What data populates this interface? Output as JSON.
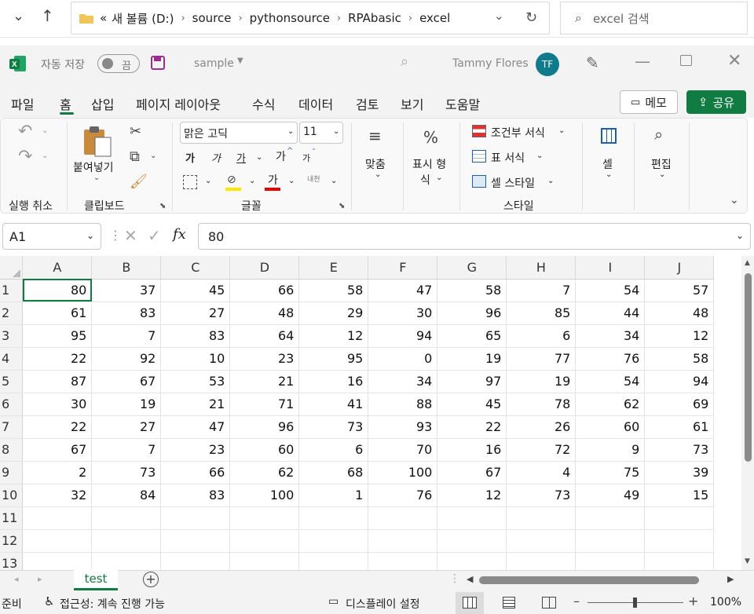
{
  "explorer": {
    "path": [
      "새 볼륨 (D:)",
      "source",
      "pythonsource",
      "RPAbasic",
      "excel"
    ],
    "path_prefix": "«",
    "search_placeholder": "excel 검색"
  },
  "titlebar": {
    "autosave_label": "자동 저장",
    "autosave_state": "끔",
    "file_name": "sample",
    "user_name": "Tammy Flores",
    "user_initials": "TF"
  },
  "menu": {
    "tabs": [
      "파일",
      "홈",
      "삽입",
      "페이지 레이아웃",
      "수식",
      "데이터",
      "검토",
      "보기",
      "도움말"
    ],
    "active_tab": "홈",
    "memo_label": "메모",
    "share_label": "공유"
  },
  "ribbon": {
    "undo_group": "실행 취소",
    "clipboard_group": "클립보드",
    "paste_label": "붙여넣기",
    "font_group": "글꼴",
    "font_name": "맑은 고딕",
    "font_size": "11",
    "bold": "가",
    "italic": "가",
    "underline": "가",
    "grow": "가",
    "shrink": "가",
    "font_color_glyph": "가",
    "phonetic": "내천",
    "align_label": "맞춤",
    "number_label_1": "표시 형",
    "number_label_2": "식",
    "styles_group": "스타일",
    "cond_format": "조건부 서식",
    "table_format": "표 서식",
    "cell_style": "셀 스타일",
    "cells_label": "셀",
    "edit_label": "편집"
  },
  "formula_bar": {
    "name_box": "A1",
    "fx": "fx",
    "value": "80"
  },
  "grid": {
    "columns": [
      "A",
      "B",
      "C",
      "D",
      "E",
      "F",
      "G",
      "H",
      "I",
      "J"
    ],
    "rows": [
      {
        "num": "1",
        "cells": [
          "80",
          "37",
          "45",
          "66",
          "58",
          "47",
          "58",
          "7",
          "54",
          "57"
        ]
      },
      {
        "num": "2",
        "cells": [
          "61",
          "83",
          "27",
          "48",
          "29",
          "30",
          "96",
          "85",
          "44",
          "48"
        ]
      },
      {
        "num": "3",
        "cells": [
          "95",
          "7",
          "83",
          "64",
          "12",
          "94",
          "65",
          "6",
          "34",
          "12"
        ]
      },
      {
        "num": "4",
        "cells": [
          "22",
          "92",
          "10",
          "23",
          "95",
          "0",
          "19",
          "77",
          "76",
          "58"
        ]
      },
      {
        "num": "5",
        "cells": [
          "87",
          "67",
          "53",
          "21",
          "16",
          "34",
          "97",
          "19",
          "54",
          "94"
        ]
      },
      {
        "num": "6",
        "cells": [
          "30",
          "19",
          "21",
          "71",
          "41",
          "88",
          "45",
          "78",
          "62",
          "69"
        ]
      },
      {
        "num": "7",
        "cells": [
          "22",
          "27",
          "47",
          "96",
          "73",
          "93",
          "22",
          "26",
          "60",
          "61"
        ]
      },
      {
        "num": "8",
        "cells": [
          "67",
          "7",
          "23",
          "60",
          "6",
          "70",
          "16",
          "72",
          "9",
          "73"
        ]
      },
      {
        "num": "9",
        "cells": [
          "2",
          "73",
          "66",
          "62",
          "68",
          "100",
          "67",
          "4",
          "75",
          "39"
        ]
      },
      {
        "num": "10",
        "cells": [
          "32",
          "84",
          "83",
          "100",
          "1",
          "76",
          "12",
          "73",
          "49",
          "15"
        ]
      },
      {
        "num": "11",
        "cells": [
          "",
          "",
          "",
          "",
          "",
          "",
          "",
          "",
          "",
          ""
        ]
      },
      {
        "num": "12",
        "cells": [
          "",
          "",
          "",
          "",
          "",
          "",
          "",
          "",
          "",
          ""
        ]
      },
      {
        "num": "13",
        "cells": [
          "",
          "",
          "",
          "",
          "",
          "",
          "",
          "",
          "",
          ""
        ]
      }
    ]
  },
  "sheets": {
    "active": "test"
  },
  "status": {
    "ready": "준비",
    "accessibility": "접근성: 계속 진행 가능",
    "display_settings": "디스플레이 설정",
    "zoom": "100%"
  },
  "colors": {
    "excel_green": "#107c41",
    "avatar": "#0f7b8c",
    "accent_underline": "#107c41"
  }
}
